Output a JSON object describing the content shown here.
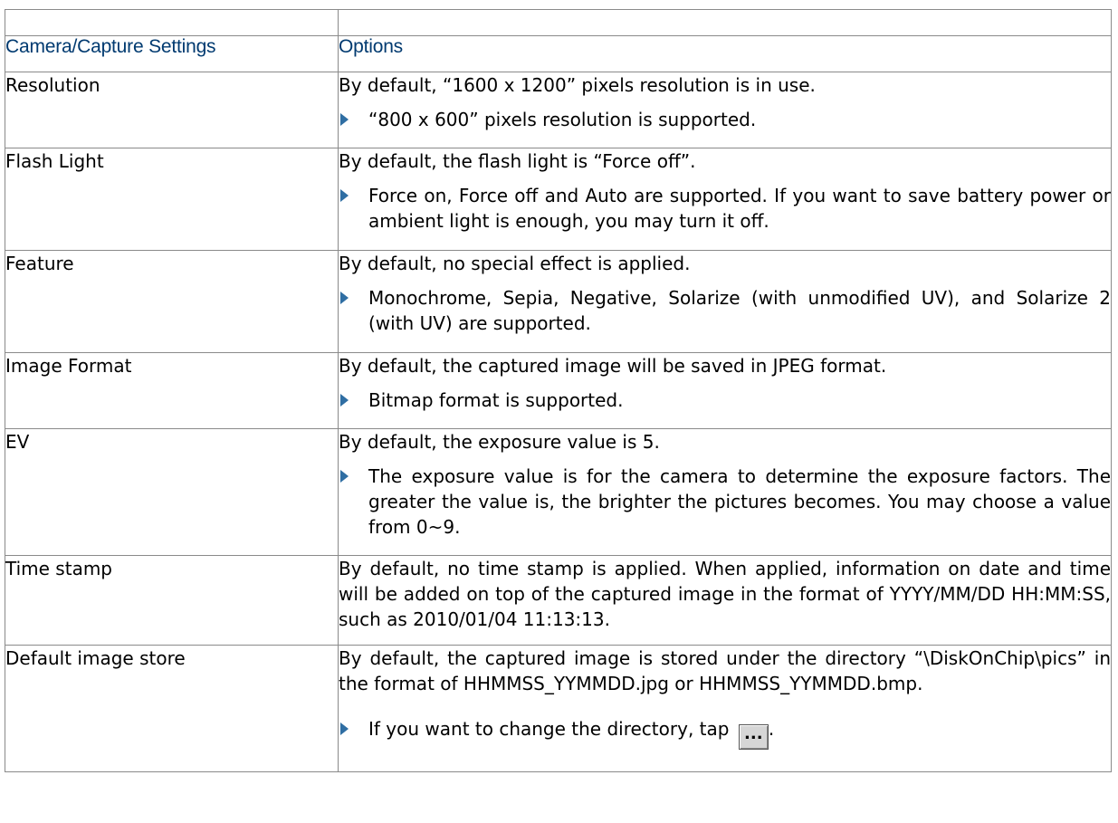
{
  "table": {
    "headers": [
      "Camera/Capture Settings",
      "Options"
    ],
    "rows": [
      {
        "name": "Resolution",
        "default": "By default, “1600 x 1200” pixels resolution is in use.",
        "bullet": "“800 x 600” pixels resolution is supported."
      },
      {
        "name": "Flash Light",
        "default": "By default, the flash light is “Force off”.",
        "bullet": "Force on, Force off and Auto are supported. If you want to save battery power or ambient light is enough, you may turn it off."
      },
      {
        "name": "Feature",
        "default": "By default, no special effect is applied.",
        "bullet": "Monochrome, Sepia, Negative, Solarize (with unmodified UV), and Solarize 2 (with UV) are supported."
      },
      {
        "name": "Image Format",
        "default": "By default, the captured image will be saved in JPEG format.",
        "bullet": "Bitmap format is supported."
      },
      {
        "name": "EV",
        "default": "By default, the exposure value is 5.",
        "bullet": "The exposure value is for the camera to determine the exposure factors. The greater the value is, the brighter the pictures becomes. You may choose a value from 0~9."
      },
      {
        "name": "Time stamp",
        "default": "By default, no time stamp is applied. When applied, information on date and time will be added on top of the captured image in the format of YYYY/MM/DD HH:MM:SS, such as 2010/01/04 11:13:13."
      },
      {
        "name": "Default image store",
        "default": "By default, the captured image is stored under the directory “\\DiskOnChip\\pics” in the format of HHMMSS_YYMMDD.jpg or HHMMSS_YYMMDD.bmp.",
        "bullet": "If you want to change the directory, tap",
        "button_label": "...",
        "bullet_end": "."
      }
    ]
  },
  "colors": {
    "header_text": "#003a70",
    "bullet": "#2f6ea3",
    "border": "#8a8a8a"
  },
  "icons": {
    "bullet": "triangle-right-icon",
    "browse": "browse-button"
  }
}
